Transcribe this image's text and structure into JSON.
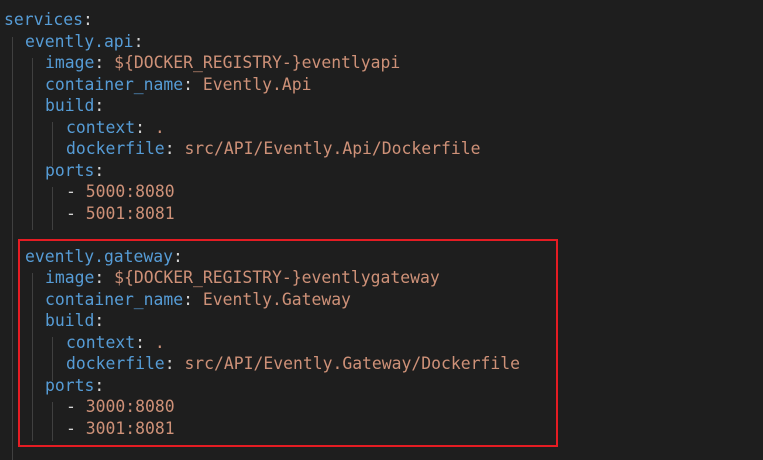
{
  "editor": {
    "language": "yaml",
    "colors": {
      "background": "#1e1e1e",
      "key": "#569cd6",
      "string": "#ce9178",
      "punctuation": "#d4d4d4",
      "indent_guide": "#404040",
      "highlight_border": "#e51c23"
    },
    "lines": {
      "l1": {
        "key": "services",
        "colon": ":"
      },
      "l2": {
        "key": "evently.api",
        "colon": ":"
      },
      "l3": {
        "key": "image",
        "colon": ": ",
        "value": "${DOCKER_REGISTRY-}eventlyapi"
      },
      "l4": {
        "key": "container_name",
        "colon": ": ",
        "value": "Evently.Api"
      },
      "l5": {
        "key": "build",
        "colon": ":"
      },
      "l6": {
        "key": "context",
        "colon": ": ",
        "value": "."
      },
      "l7": {
        "key": "dockerfile",
        "colon": ": ",
        "value": "src/API/Evently.Api/Dockerfile"
      },
      "l8": {
        "key": "ports",
        "colon": ":"
      },
      "l9": {
        "dash": "- ",
        "value": "5000:8080"
      },
      "l10": {
        "dash": "- ",
        "value": "5001:8081"
      },
      "l12": {
        "key": "evently.gateway",
        "colon": ":"
      },
      "l13": {
        "key": "image",
        "colon": ": ",
        "value": "${DOCKER_REGISTRY-}eventlygateway"
      },
      "l14": {
        "key": "container_name",
        "colon": ": ",
        "value": "Evently.Gateway"
      },
      "l15": {
        "key": "build",
        "colon": ":"
      },
      "l16": {
        "key": "context",
        "colon": ": ",
        "value": "."
      },
      "l17": {
        "key": "dockerfile",
        "colon": ": ",
        "value": "src/API/Evently.Gateway/Dockerfile"
      },
      "l18": {
        "key": "ports",
        "colon": ":"
      },
      "l19": {
        "dash": "- ",
        "value": "3000:8080"
      },
      "l20": {
        "dash": "- ",
        "value": "3001:8081"
      }
    }
  }
}
